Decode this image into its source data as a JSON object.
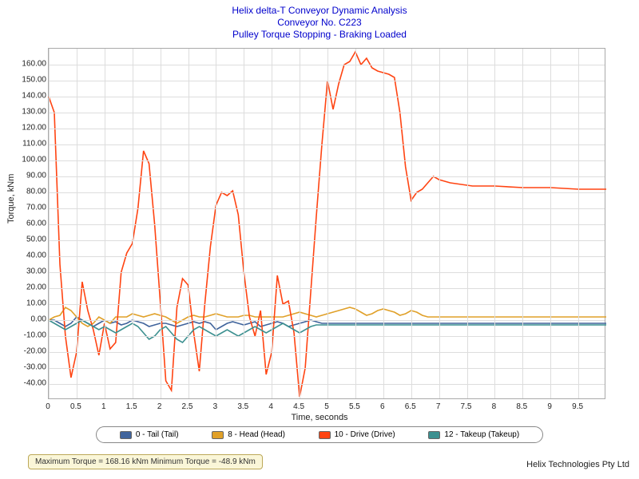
{
  "titles": {
    "line1": "Helix delta-T Conveyor Dynamic Analysis",
    "line2": "Conveyor No. C223",
    "line3": "Pulley Torque Stopping - Braking Loaded"
  },
  "axes": {
    "xlabel": "Time, seconds",
    "ylabel": "Torque, kNm",
    "xmin": 0,
    "xmax": 10,
    "ymin": -50,
    "ymax": 170,
    "xticks": [
      0,
      0.5,
      1,
      1.5,
      2,
      2.5,
      3,
      3.5,
      4,
      4.5,
      5,
      5.5,
      6,
      6.5,
      7,
      7.5,
      8,
      8.5,
      9,
      9.5
    ],
    "yticks": [
      -40,
      -30,
      -20,
      -10,
      0,
      10,
      20,
      30,
      40,
      50,
      60,
      70,
      80,
      90,
      100,
      110,
      120,
      130,
      140,
      150,
      160
    ]
  },
  "legend": [
    {
      "label": "0 - Tail (Tail)",
      "color": "#40649c"
    },
    {
      "label": "8 - Head (Head)",
      "color": "#e0a028"
    },
    {
      "label": "10 - Drive (Drive)",
      "color": "#ff4412"
    },
    {
      "label": "12 - Takeup (Takeup)",
      "color": "#3c9090"
    }
  ],
  "status": "Maximum Torque = 168.16 kNm Minimum Torque = -48.9 kNm",
  "footer": "Helix Technologies Pty Ltd",
  "chart_data": {
    "type": "line",
    "title": "Pulley Torque Stopping - Braking Loaded",
    "xlabel": "Time, seconds",
    "ylabel": "Torque, kNm",
    "xlim": [
      0,
      10
    ],
    "ylim": [
      -50,
      170
    ],
    "x": [
      0,
      0.1,
      0.2,
      0.3,
      0.4,
      0.5,
      0.6,
      0.7,
      0.8,
      0.9,
      1.0,
      1.1,
      1.2,
      1.3,
      1.4,
      1.5,
      1.6,
      1.7,
      1.8,
      1.9,
      2.0,
      2.1,
      2.2,
      2.3,
      2.4,
      2.5,
      2.6,
      2.7,
      2.8,
      2.9,
      3.0,
      3.1,
      3.2,
      3.3,
      3.4,
      3.5,
      3.6,
      3.7,
      3.8,
      3.9,
      4.0,
      4.1,
      4.2,
      4.3,
      4.4,
      4.5,
      4.6,
      4.7,
      4.8,
      4.9,
      5.0,
      5.1,
      5.2,
      5.3,
      5.4,
      5.5,
      5.6,
      5.7,
      5.8,
      5.9,
      6.0,
      6.1,
      6.2,
      6.3,
      6.4,
      6.5,
      6.6,
      6.7,
      6.8,
      6.9,
      7.0,
      7.2,
      7.4,
      7.6,
      7.8,
      8.0,
      8.5,
      9.0,
      9.5,
      10.0
    ],
    "series": [
      {
        "name": "0 - Tail (Tail)",
        "color": "#40649c",
        "values": [
          0,
          0,
          -2,
          -4,
          -2,
          2,
          0,
          -2,
          -4,
          -2,
          0,
          -2,
          -1,
          -3,
          -2,
          0,
          -1,
          -2,
          -4,
          -3,
          -2,
          -2,
          -3,
          -4,
          -3,
          -2,
          -1,
          -2,
          -1,
          -2,
          -6,
          -4,
          -2,
          -1,
          -2,
          -3,
          -2,
          -1,
          -4,
          -3,
          -2,
          -1,
          -2,
          -4,
          -3,
          -2,
          -1,
          0,
          -1,
          -2,
          -2,
          -2,
          -2,
          -2,
          -2,
          -2,
          -2,
          -2,
          -2,
          -2,
          -2,
          -2,
          -2,
          -2,
          -2,
          -2,
          -2,
          -2,
          -2,
          -2,
          -2,
          -2,
          -2,
          -2,
          -2,
          -2,
          -2,
          -2,
          -2,
          -2
        ]
      },
      {
        "name": "8 - Head (Head)",
        "color": "#e0a028",
        "values": [
          0,
          2,
          3,
          8,
          6,
          2,
          -2,
          -4,
          -2,
          2,
          0,
          -2,
          2,
          2,
          2,
          4,
          3,
          2,
          3,
          4,
          3,
          2,
          0,
          -2,
          0,
          2,
          3,
          2,
          2,
          3,
          4,
          3,
          2,
          2,
          2,
          3,
          3,
          2,
          2,
          2,
          2,
          2,
          2,
          3,
          4,
          5,
          4,
          3,
          2,
          3,
          4,
          5,
          6,
          7,
          8,
          7,
          5,
          3,
          4,
          6,
          7,
          6,
          5,
          3,
          4,
          6,
          5,
          3,
          2,
          2,
          2,
          2,
          2,
          2,
          2,
          2,
          2,
          2,
          2,
          2
        ]
      },
      {
        "name": "10 - Drive (Drive)",
        "color": "#ff4412",
        "values": [
          140,
          130,
          35,
          -10,
          -36,
          -20,
          24,
          6,
          -6,
          -22,
          -2,
          -18,
          -14,
          30,
          42,
          48,
          70,
          106,
          98,
          60,
          12,
          -38,
          -44,
          8,
          26,
          22,
          -8,
          -32,
          10,
          46,
          72,
          80,
          78,
          81,
          66,
          30,
          2,
          -10,
          6,
          -34,
          -20,
          28,
          10,
          12,
          -8,
          -48,
          -30,
          18,
          65,
          110,
          150,
          132,
          148,
          160,
          162,
          168,
          160,
          164,
          158,
          156,
          155,
          154,
          152,
          130,
          96,
          75,
          80,
          82,
          86,
          90,
          88,
          86,
          85,
          84,
          84,
          84,
          83,
          83,
          82,
          82
        ]
      },
      {
        "name": "12 - Takeup (Takeup)",
        "color": "#3c9090",
        "values": [
          0,
          -2,
          -4,
          -6,
          -4,
          -2,
          0,
          -2,
          -4,
          -6,
          -4,
          -6,
          -8,
          -6,
          -4,
          -2,
          -4,
          -8,
          -12,
          -10,
          -6,
          -4,
          -8,
          -12,
          -14,
          -10,
          -6,
          -4,
          -6,
          -8,
          -10,
          -8,
          -6,
          -8,
          -10,
          -8,
          -6,
          -4,
          -6,
          -8,
          -6,
          -4,
          -2,
          -4,
          -6,
          -8,
          -6,
          -4,
          -3,
          -3,
          -3,
          -3,
          -3,
          -3,
          -3,
          -3,
          -3,
          -3,
          -3,
          -3,
          -3,
          -3,
          -3,
          -3,
          -3,
          -3,
          -3,
          -3,
          -3,
          -3,
          -3,
          -3,
          -3,
          -3,
          -3,
          -3,
          -3,
          -3,
          -3,
          -3
        ]
      }
    ]
  }
}
